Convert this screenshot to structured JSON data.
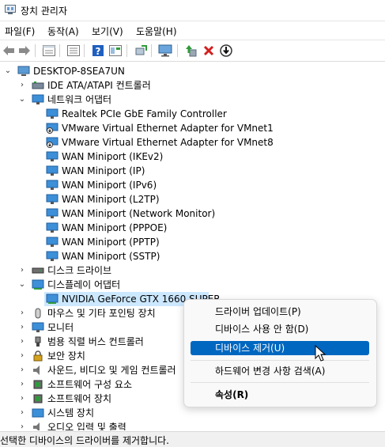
{
  "window": {
    "title": "장치 관리자"
  },
  "menu": [
    "파일(F)",
    "동작(A)",
    "보기(V)",
    "도움말(H)"
  ],
  "toolbar": {
    "icons": [
      "back-icon",
      "forward-icon",
      "properties-icon",
      "details-icon",
      "help-icon",
      "view-icon",
      "scan-icon",
      "monitor-icon",
      "update-driver-icon",
      "uninstall-icon",
      "disable-icon"
    ],
    "colors": {
      "green": "#2e9b3a",
      "red": "#d21f1f",
      "blue": "#1f5fbf"
    }
  },
  "tree": {
    "root": "DESKTOP-8SEA7UN",
    "ide": "IDE ATA/ATAPI 컨트롤러",
    "network": {
      "label": "네트워크 어댑터",
      "children": [
        "Realtek PCIe GbE Family Controller",
        "VMware Virtual Ethernet Adapter for VMnet1",
        "VMware Virtual Ethernet Adapter for VMnet8",
        "WAN Miniport (IKEv2)",
        "WAN Miniport (IP)",
        "WAN Miniport (IPv6)",
        "WAN Miniport (L2TP)",
        "WAN Miniport (Network Monitor)",
        "WAN Miniport (PPPOE)",
        "WAN Miniport (PPTP)",
        "WAN Miniport (SSTP)"
      ]
    },
    "disk": "디스크 드라이브",
    "display": {
      "label": "디스플레이 어댑터",
      "child": "NVIDIA GeForce GTX 1660 SUPER"
    },
    "mouse": "마우스 및 기타 포인팅 장치",
    "monitor": "모니터",
    "usb": "범용 직렬 버스 컨트롤러",
    "security": "보안 장치",
    "sound": "사운드, 비디오 및 게임 컨트롤러",
    "swcomp": "소프트웨어 구성 요소",
    "swdev": "소프트웨어 장치",
    "system": "시스템 장치",
    "audio": "오디오 입력 및 출력"
  },
  "context_menu": {
    "update": "드라이버 업데이트(P)",
    "disable": "디바이스 사용 안 함(D)",
    "uninstall": "디바이스 제거(U)",
    "scan": "하드웨어 변경 사항 검색(A)",
    "properties": "속성(R)"
  },
  "status": "선택한 디바이스의 드라이버를 제거합니다.",
  "colors": {
    "selection": "#cce8ff",
    "menu_highlight": "#0067c0"
  }
}
